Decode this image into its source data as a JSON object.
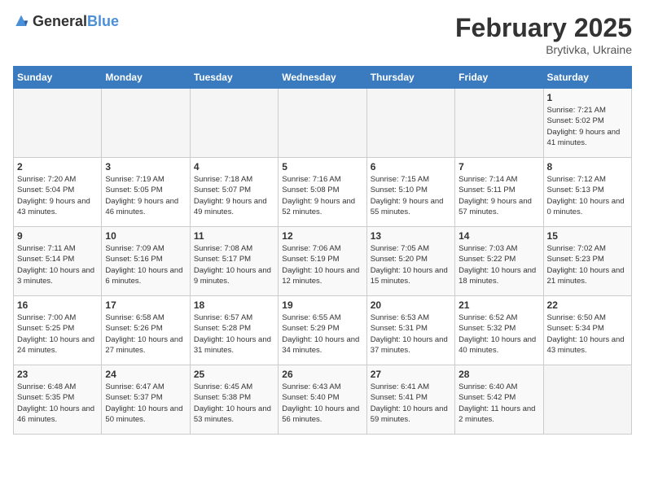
{
  "logo": {
    "text_general": "General",
    "text_blue": "Blue"
  },
  "header": {
    "month": "February 2025",
    "location": "Brytivka, Ukraine"
  },
  "weekdays": [
    "Sunday",
    "Monday",
    "Tuesday",
    "Wednesday",
    "Thursday",
    "Friday",
    "Saturday"
  ],
  "weeks": [
    [
      {
        "day": "",
        "info": ""
      },
      {
        "day": "",
        "info": ""
      },
      {
        "day": "",
        "info": ""
      },
      {
        "day": "",
        "info": ""
      },
      {
        "day": "",
        "info": ""
      },
      {
        "day": "",
        "info": ""
      },
      {
        "day": "1",
        "info": "Sunrise: 7:21 AM\nSunset: 5:02 PM\nDaylight: 9 hours and 41 minutes."
      }
    ],
    [
      {
        "day": "2",
        "info": "Sunrise: 7:20 AM\nSunset: 5:04 PM\nDaylight: 9 hours and 43 minutes."
      },
      {
        "day": "3",
        "info": "Sunrise: 7:19 AM\nSunset: 5:05 PM\nDaylight: 9 hours and 46 minutes."
      },
      {
        "day": "4",
        "info": "Sunrise: 7:18 AM\nSunset: 5:07 PM\nDaylight: 9 hours and 49 minutes."
      },
      {
        "day": "5",
        "info": "Sunrise: 7:16 AM\nSunset: 5:08 PM\nDaylight: 9 hours and 52 minutes."
      },
      {
        "day": "6",
        "info": "Sunrise: 7:15 AM\nSunset: 5:10 PM\nDaylight: 9 hours and 55 minutes."
      },
      {
        "day": "7",
        "info": "Sunrise: 7:14 AM\nSunset: 5:11 PM\nDaylight: 9 hours and 57 minutes."
      },
      {
        "day": "8",
        "info": "Sunrise: 7:12 AM\nSunset: 5:13 PM\nDaylight: 10 hours and 0 minutes."
      }
    ],
    [
      {
        "day": "9",
        "info": "Sunrise: 7:11 AM\nSunset: 5:14 PM\nDaylight: 10 hours and 3 minutes."
      },
      {
        "day": "10",
        "info": "Sunrise: 7:09 AM\nSunset: 5:16 PM\nDaylight: 10 hours and 6 minutes."
      },
      {
        "day": "11",
        "info": "Sunrise: 7:08 AM\nSunset: 5:17 PM\nDaylight: 10 hours and 9 minutes."
      },
      {
        "day": "12",
        "info": "Sunrise: 7:06 AM\nSunset: 5:19 PM\nDaylight: 10 hours and 12 minutes."
      },
      {
        "day": "13",
        "info": "Sunrise: 7:05 AM\nSunset: 5:20 PM\nDaylight: 10 hours and 15 minutes."
      },
      {
        "day": "14",
        "info": "Sunrise: 7:03 AM\nSunset: 5:22 PM\nDaylight: 10 hours and 18 minutes."
      },
      {
        "day": "15",
        "info": "Sunrise: 7:02 AM\nSunset: 5:23 PM\nDaylight: 10 hours and 21 minutes."
      }
    ],
    [
      {
        "day": "16",
        "info": "Sunrise: 7:00 AM\nSunset: 5:25 PM\nDaylight: 10 hours and 24 minutes."
      },
      {
        "day": "17",
        "info": "Sunrise: 6:58 AM\nSunset: 5:26 PM\nDaylight: 10 hours and 27 minutes."
      },
      {
        "day": "18",
        "info": "Sunrise: 6:57 AM\nSunset: 5:28 PM\nDaylight: 10 hours and 31 minutes."
      },
      {
        "day": "19",
        "info": "Sunrise: 6:55 AM\nSunset: 5:29 PM\nDaylight: 10 hours and 34 minutes."
      },
      {
        "day": "20",
        "info": "Sunrise: 6:53 AM\nSunset: 5:31 PM\nDaylight: 10 hours and 37 minutes."
      },
      {
        "day": "21",
        "info": "Sunrise: 6:52 AM\nSunset: 5:32 PM\nDaylight: 10 hours and 40 minutes."
      },
      {
        "day": "22",
        "info": "Sunrise: 6:50 AM\nSunset: 5:34 PM\nDaylight: 10 hours and 43 minutes."
      }
    ],
    [
      {
        "day": "23",
        "info": "Sunrise: 6:48 AM\nSunset: 5:35 PM\nDaylight: 10 hours and 46 minutes."
      },
      {
        "day": "24",
        "info": "Sunrise: 6:47 AM\nSunset: 5:37 PM\nDaylight: 10 hours and 50 minutes."
      },
      {
        "day": "25",
        "info": "Sunrise: 6:45 AM\nSunset: 5:38 PM\nDaylight: 10 hours and 53 minutes."
      },
      {
        "day": "26",
        "info": "Sunrise: 6:43 AM\nSunset: 5:40 PM\nDaylight: 10 hours and 56 minutes."
      },
      {
        "day": "27",
        "info": "Sunrise: 6:41 AM\nSunset: 5:41 PM\nDaylight: 10 hours and 59 minutes."
      },
      {
        "day": "28",
        "info": "Sunrise: 6:40 AM\nSunset: 5:42 PM\nDaylight: 11 hours and 2 minutes."
      },
      {
        "day": "",
        "info": ""
      }
    ]
  ]
}
